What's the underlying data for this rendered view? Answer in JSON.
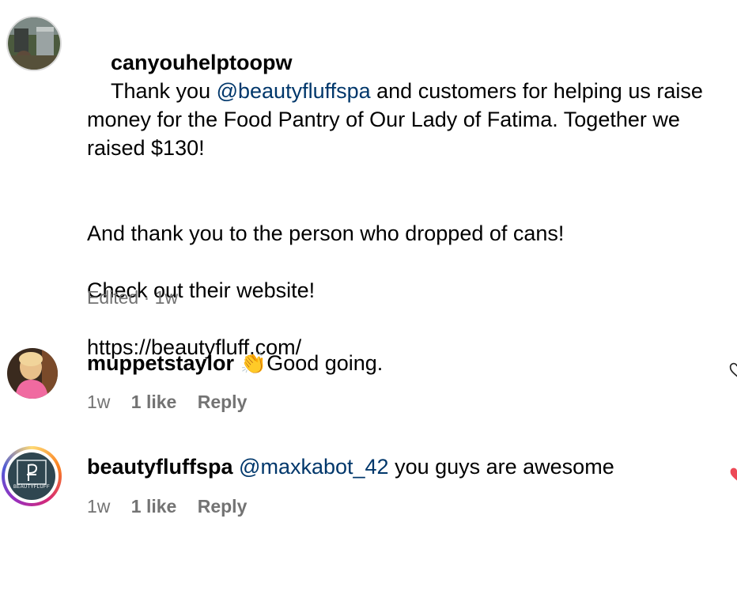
{
  "comments": [
    {
      "username": "canyouhelptoopw",
      "text_before_mention": "Thank you ",
      "mention": "@beautyfluffspa",
      "text_after_mention": " and customers for helping us raise money for the Food Pantry of Our Lady of Fatima. Together we raised $130!",
      "paragraph_2": "And thank you to the person who dropped of cans!",
      "paragraph_3": "Check out their website!",
      "paragraph_4": "https://beautyfluff.com/",
      "meta": "Edited · 1w"
    },
    {
      "username": "muppetstaylor",
      "emoji": "👏",
      "text": "Good going.",
      "time": "1w",
      "likes": "1 like",
      "reply": "Reply"
    },
    {
      "username": "beautyfluffspa",
      "mention": "@maxkabot_42",
      "text": " you guys are awesome",
      "time": "1w",
      "likes": "1 like",
      "reply": "Reply",
      "avatar_logo_text": "BEAUTYFLUFF"
    }
  ],
  "colors": {
    "mention": "#00376b",
    "meta": "#737373",
    "liked_heart": "#ed4956"
  }
}
